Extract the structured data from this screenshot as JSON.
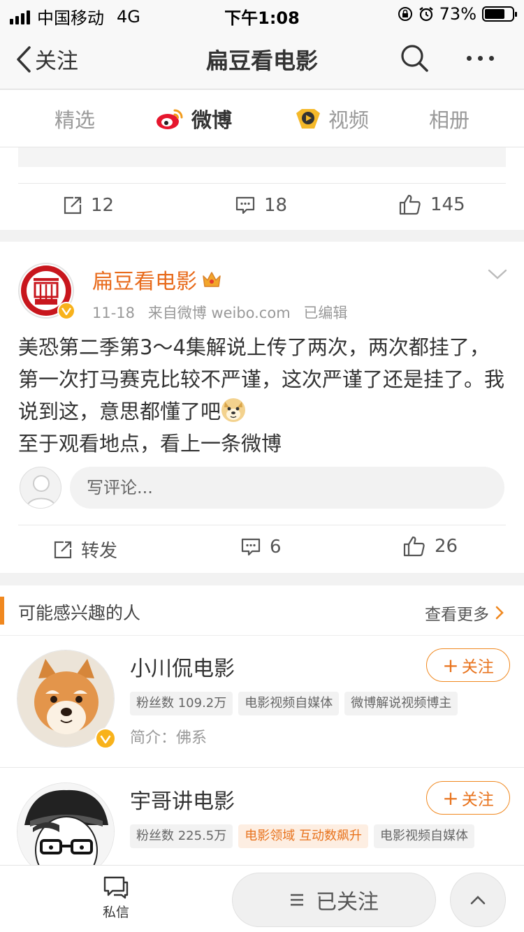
{
  "status_bar": {
    "carrier": "中国移动",
    "network": "4G",
    "time": "下午1:08",
    "battery": "73%",
    "battery_level": 0.73
  },
  "nav": {
    "back_label": "关注",
    "title": "扁豆看电影"
  },
  "tabs": [
    {
      "label": "精选",
      "icon": ""
    },
    {
      "label": "微博",
      "icon": "weibo-icon"
    },
    {
      "label": "视频",
      "icon": "video-icon"
    },
    {
      "label": "相册",
      "icon": ""
    }
  ],
  "prev_post": {
    "repost_count": "12",
    "comment_count": "18",
    "like_count": "145"
  },
  "post": {
    "author": "扁豆看电影",
    "date": "11-18",
    "source": "来自微博 weibo.com",
    "edited": "已编辑",
    "text_main": "美恐第二季第3～4集解说上传了两次，两次都挂了，第一次打马赛克比较不严谨，这次严谨了还是挂了。我说到这，意思都懂了吧",
    "text_tail": "至于观看地点，看上一条微博",
    "comment_placeholder": "写评论...",
    "repost_label": "转发",
    "comment_count": "6",
    "like_count": "26"
  },
  "suggestions": {
    "title": "可能感兴趣的人",
    "more_label": "查看更多",
    "follow_label": "关注",
    "people": [
      {
        "name": "小川侃电影",
        "tags": [
          "粉丝数 109.2万",
          "电影视频自媒体",
          "微博解说视频博主"
        ],
        "intro": "简介：佛系"
      },
      {
        "name": "宇哥讲电影",
        "tags": [
          "粉丝数 225.5万",
          "电影领域 互动数飙升",
          "电影视频自媒体"
        ],
        "intro": ""
      }
    ]
  },
  "bottom": {
    "dm_label": "私信",
    "followed_label": "已关注"
  },
  "colors": {
    "accent": "#f0881f",
    "name_orange": "#e86b1c",
    "verified": "#f8b21b",
    "weibo_red": "#e6162d"
  }
}
